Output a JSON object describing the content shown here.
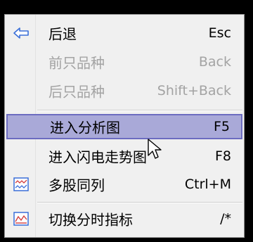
{
  "menu": {
    "items": [
      {
        "label": "后退",
        "shortcut": "Esc",
        "icon": "left-arrow-icon",
        "disabled": false
      },
      {
        "label": "前只品种",
        "shortcut": "Back",
        "icon": null,
        "disabled": true
      },
      {
        "label": "后只品种",
        "shortcut": "Shift+Back",
        "icon": null,
        "disabled": true
      },
      {
        "label": "进入分析图",
        "shortcut": "F5",
        "icon": null,
        "disabled": false,
        "highlighted": true
      },
      {
        "label": "进入闪电走势图",
        "shortcut": "F8",
        "icon": null,
        "disabled": false
      },
      {
        "label": "多股同列",
        "shortcut": "Ctrl+M",
        "icon": "multi-chart-icon",
        "disabled": false
      },
      {
        "label": "切换分时指标",
        "shortcut": "/*",
        "icon": "indicator-chart-icon",
        "disabled": false
      }
    ]
  },
  "colors": {
    "menu_bg": "#f0f0f0",
    "highlight_bg": "#a9a9d8",
    "highlight_border": "#6c6cc0",
    "disabled_text": "#a3a3a3",
    "icon_blue": "#3a6fd8",
    "icon_red": "#d23c3c"
  }
}
